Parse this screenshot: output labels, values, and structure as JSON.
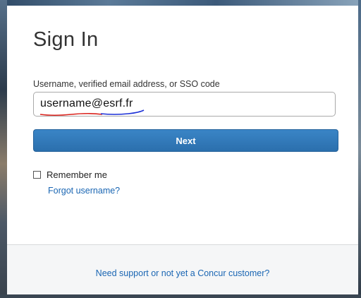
{
  "page": {
    "title": "Sign In"
  },
  "login_form": {
    "username_label": "Username, verified email address, or SSO code",
    "username_value": "username@esrf.fr",
    "next_label": "Next",
    "remember_label": "Remember me",
    "remember_checked": false,
    "forgot_label": "Forgot username?"
  },
  "footer": {
    "support_label": "Need support or not yet a Concur customer?"
  },
  "annotations": {
    "red_underline_color": "#d9221c",
    "blue_underline_color": "#1b2fd6"
  },
  "colors": {
    "button": "#2f76b8",
    "link": "#1a66b3"
  }
}
